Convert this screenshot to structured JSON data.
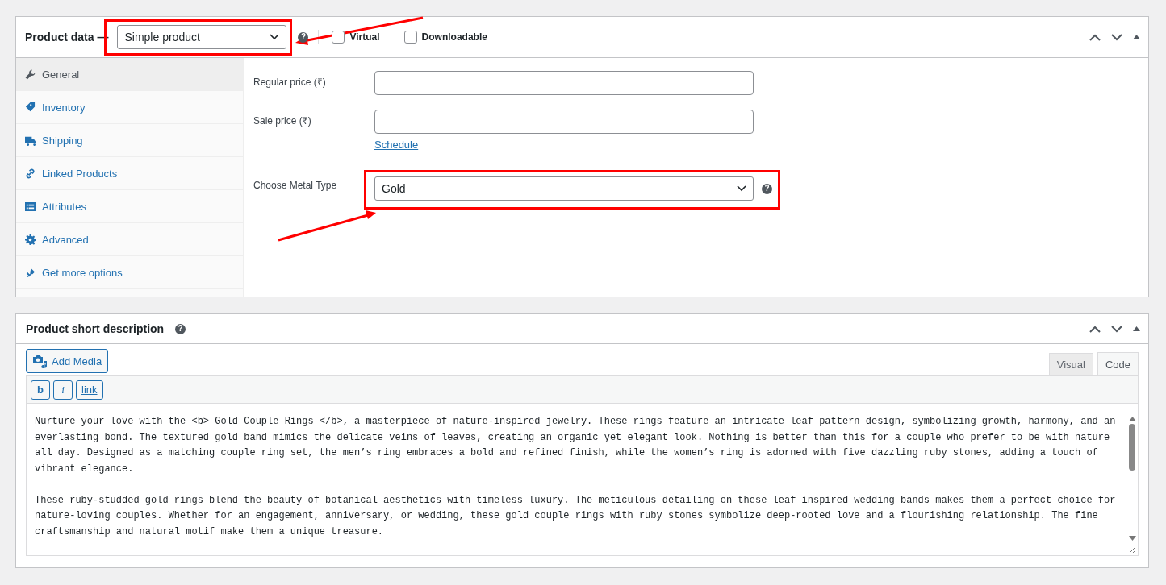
{
  "product_data": {
    "title": "Product data —",
    "product_type": "Simple product",
    "help": "?",
    "options": [
      {
        "label": "Virtual",
        "checked": false
      },
      {
        "label": "Downloadable",
        "checked": false
      }
    ],
    "tabs": [
      {
        "label": "General",
        "selected": true
      },
      {
        "label": "Inventory",
        "selected": false
      },
      {
        "label": "Shipping",
        "selected": false
      },
      {
        "label": "Linked Products",
        "selected": false
      },
      {
        "label": "Attributes",
        "selected": false
      },
      {
        "label": "Advanced",
        "selected": false
      },
      {
        "label": "Get more options",
        "selected": false
      }
    ],
    "price_fields": [
      {
        "label": "Regular price (₹)"
      },
      {
        "label": "Sale price (₹)",
        "link": "Schedule"
      }
    ],
    "metal": {
      "label": "Choose Metal Type",
      "value": "Gold",
      "help": "?"
    }
  },
  "short_description": {
    "title": "Product short description",
    "help": "?",
    "add_media": "Add Media",
    "quicktags": [
      {
        "label": "b",
        "kind": "bold"
      },
      {
        "label": "i",
        "kind": "italic"
      },
      {
        "label": "link",
        "kind": "link"
      }
    ],
    "editor_tabs": [
      {
        "label": "Visual",
        "selected": false
      },
      {
        "label": "Code",
        "selected": true
      }
    ],
    "paragraphs": [
      "Nurture your love with the <b> Gold Couple Rings </b>, a masterpiece of nature-inspired jewelry. These rings feature an intricate leaf pattern design, symbolizing growth, harmony, and an everlasting bond. The textured gold band mimics the delicate veins of leaves, creating an organic yet elegant look. Nothing is better than this for a couple who prefer to be with nature all day. Designed as a matching couple ring set, the men’s ring embraces a bold and refined finish, while the women’s ring is adorned with five dazzling ruby stones, adding a touch of vibrant elegance.",
      "These ruby-studded gold rings blend the beauty of botanical aesthetics with timeless luxury. The meticulous detailing on these leaf inspired wedding bands makes them a perfect choice for nature-loving couples. Whether for an engagement, anniversary, or wedding, these gold couple rings with ruby stones symbolize deep-rooted love and a flourishing relationship. The fine craftsmanship and natural motif make them a unique treasure."
    ]
  }
}
